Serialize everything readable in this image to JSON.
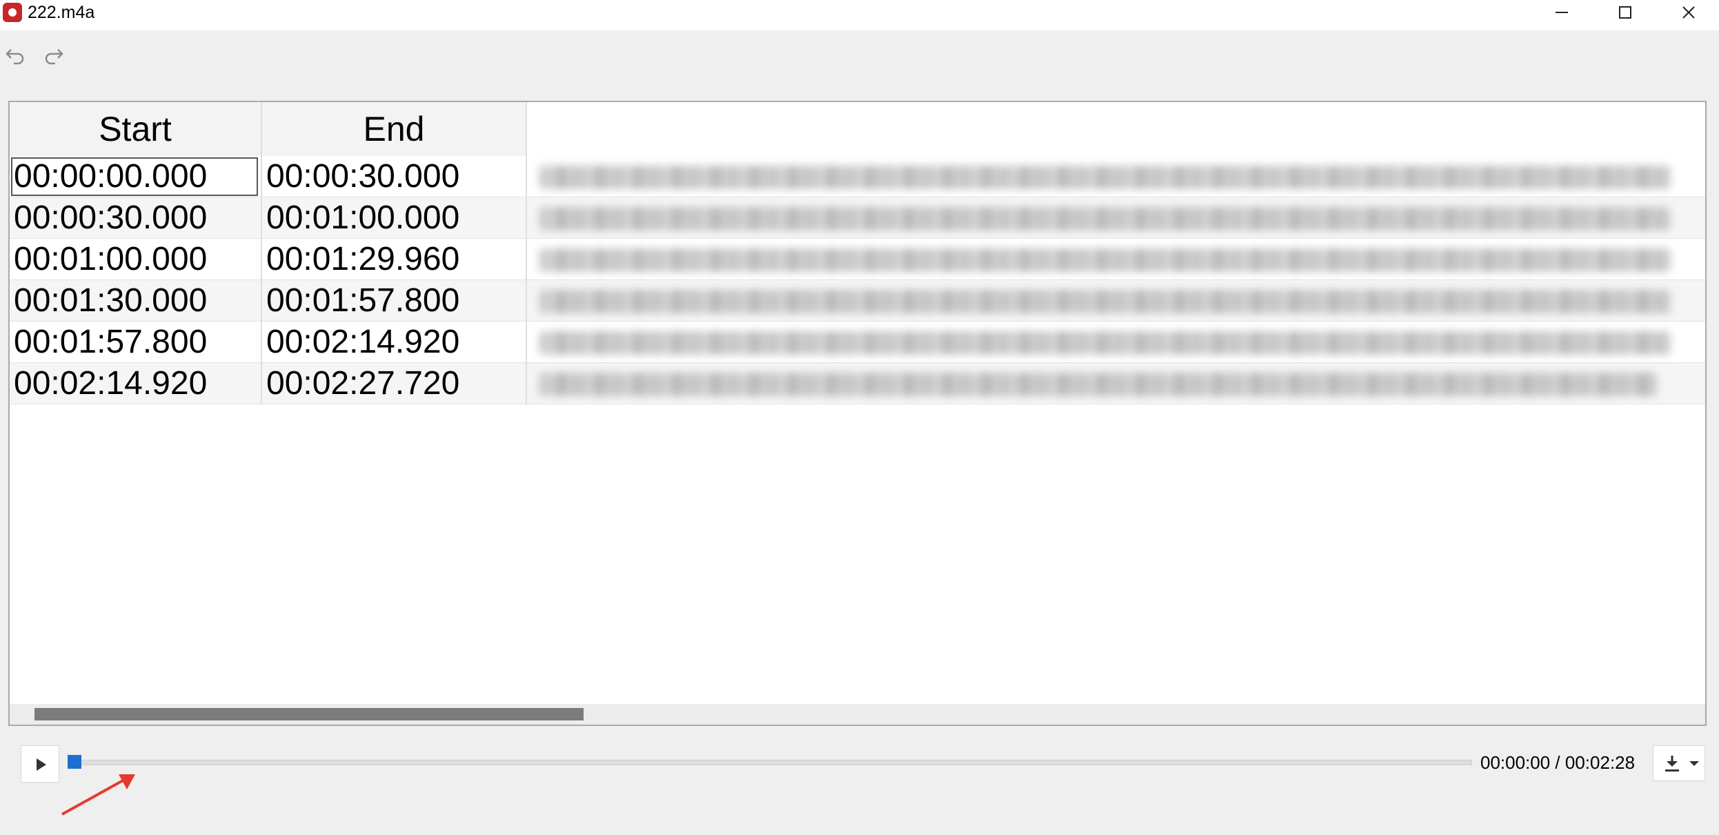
{
  "window": {
    "title": "222.m4a",
    "icon": "app-record-icon"
  },
  "titlebar_controls": [
    "minimize-icon",
    "maximize-icon",
    "close-icon"
  ],
  "toolbar": {
    "buttons": [
      "undo-icon",
      "redo-icon"
    ]
  },
  "table": {
    "columns": [
      "Start",
      "End",
      ""
    ],
    "rows": [
      {
        "start": "00:00:00.000",
        "end": "00:00:30.000"
      },
      {
        "start": "00:00:30.000",
        "end": "00:01:00.000"
      },
      {
        "start": "00:01:00.000",
        "end": "00:01:29.960"
      },
      {
        "start": "00:01:30.000",
        "end": "00:01:57.800"
      },
      {
        "start": "00:01:57.800",
        "end": "00:02:14.920"
      },
      {
        "start": "00:02:14.920",
        "end": "00:02:27.720"
      }
    ],
    "text_column_state": "blurred",
    "selected_row": 0
  },
  "player": {
    "play_icon": "play-icon",
    "position_fraction": 0,
    "time_display": "00:00:00 / 00:02:28",
    "export_icon": "download-icon",
    "export_menu_icon": "chevron-down-icon"
  },
  "annotation": {
    "type": "arrow",
    "color": "#e53a2e"
  },
  "colors": {
    "accent": "#1e6fd0",
    "app_icon": "#c8262c",
    "annotation": "#e53a2e"
  }
}
